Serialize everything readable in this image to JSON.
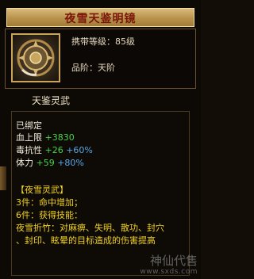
{
  "tooltip": {
    "title": "夜雪天鉴明镜",
    "level_label": "携带等级：85级",
    "grade_label": "品阶：天阶",
    "sub_title": "天鉴灵武",
    "bound_status": "已绑定",
    "stats": [
      {
        "name": "血上限",
        "base": "+3830",
        "bonus": ""
      },
      {
        "name": "毒抗性",
        "base": "+26",
        "bonus": "+60%"
      },
      {
        "name": "体力",
        "base": "+59",
        "bonus": "+80%"
      }
    ],
    "set": {
      "title": "【夜雪灵武】",
      "lines": [
        "3件：命中增加；",
        "6件：获得技能：",
        "夜雪折竹：对麻痹、失明、散功、封穴",
        "、封印、眩晕的目标造成的伤害提高"
      ]
    },
    "watermark": {
      "text": "神仙代售",
      "url": "www.sxds.com"
    }
  },
  "colors": {
    "title_text": "#7a1508",
    "stat_base": "#47d444",
    "stat_bonus": "#5aa6e8",
    "set_text": "#f0d020"
  }
}
